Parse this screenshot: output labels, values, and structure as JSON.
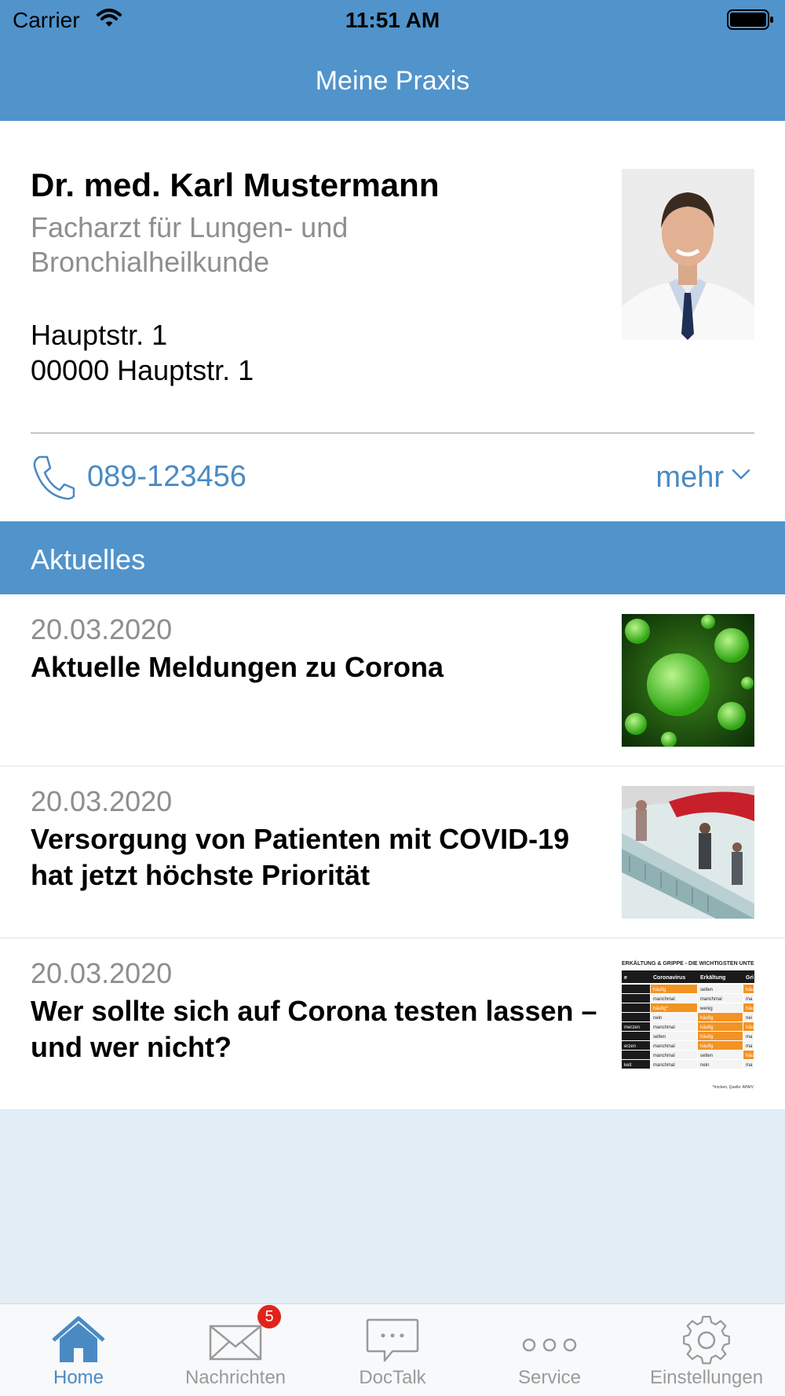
{
  "status_bar": {
    "carrier": "Carrier",
    "time": "11:51 AM"
  },
  "nav": {
    "title": "Meine Praxis"
  },
  "profile": {
    "name": "Dr. med. Karl Mustermann",
    "specialty": "Facharzt für Lungen- und Bronchialheilkunde",
    "address_line1": "Hauptstr. 1",
    "address_line2": "00000 Hauptstr. 1",
    "phone": "089-123456",
    "more_label": "mehr"
  },
  "news_section": {
    "title": "Aktuelles",
    "items": [
      {
        "date": "20.03.2020",
        "headline": "Aktuelle Meldungen zu Corona"
      },
      {
        "date": "20.03.2020",
        "headline": "Versorgung von Patienten mit COVID-19 hat jetzt höchste Priorität"
      },
      {
        "date": "20.03.2020",
        "headline": "Wer sollte sich auf Corona testen lassen – und wer nicht?"
      }
    ],
    "table_thumb": {
      "title": "ERKÄLTUNG & GRIPPE - DIE WICHTIGSTEN UNTERS",
      "headers": [
        "e",
        "Coronavirus",
        "Erkältung",
        "Gri"
      ],
      "rows": [
        [
          "",
          "häufig",
          "selten",
          "häu"
        ],
        [
          "",
          "manchmal",
          "manchmal",
          "ma"
        ],
        [
          "",
          "häufig*",
          "wenig",
          "häu"
        ],
        [
          "",
          "nein",
          "häufig",
          "nei"
        ],
        [
          "merzen",
          "manchmal",
          "häufig",
          "häu"
        ],
        [
          "",
          "selten",
          "häufig",
          "ma"
        ],
        [
          "erzen",
          "manchmal",
          "häufig",
          "ma"
        ],
        [
          "",
          "manchmal",
          "selten",
          "häu"
        ],
        [
          "keit",
          "manchmal",
          "nein",
          "ma"
        ]
      ],
      "source": "*trocken, Quelle: APA/V"
    }
  },
  "tab_bar": {
    "tabs": [
      {
        "label": "Home",
        "icon": "home-icon",
        "active": true
      },
      {
        "label": "Nachrichten",
        "icon": "envelope-icon",
        "badge": "5"
      },
      {
        "label": "DocTalk",
        "icon": "chat-bubble-icon"
      },
      {
        "label": "Service",
        "icon": "dots-icon"
      },
      {
        "label": "Einstellungen",
        "icon": "gear-icon"
      }
    ]
  },
  "colors": {
    "primary": "#5193cb",
    "link": "#4a8ac4",
    "background": "#e3edf6",
    "badge": "#e2231a",
    "orange": "#f39323"
  }
}
